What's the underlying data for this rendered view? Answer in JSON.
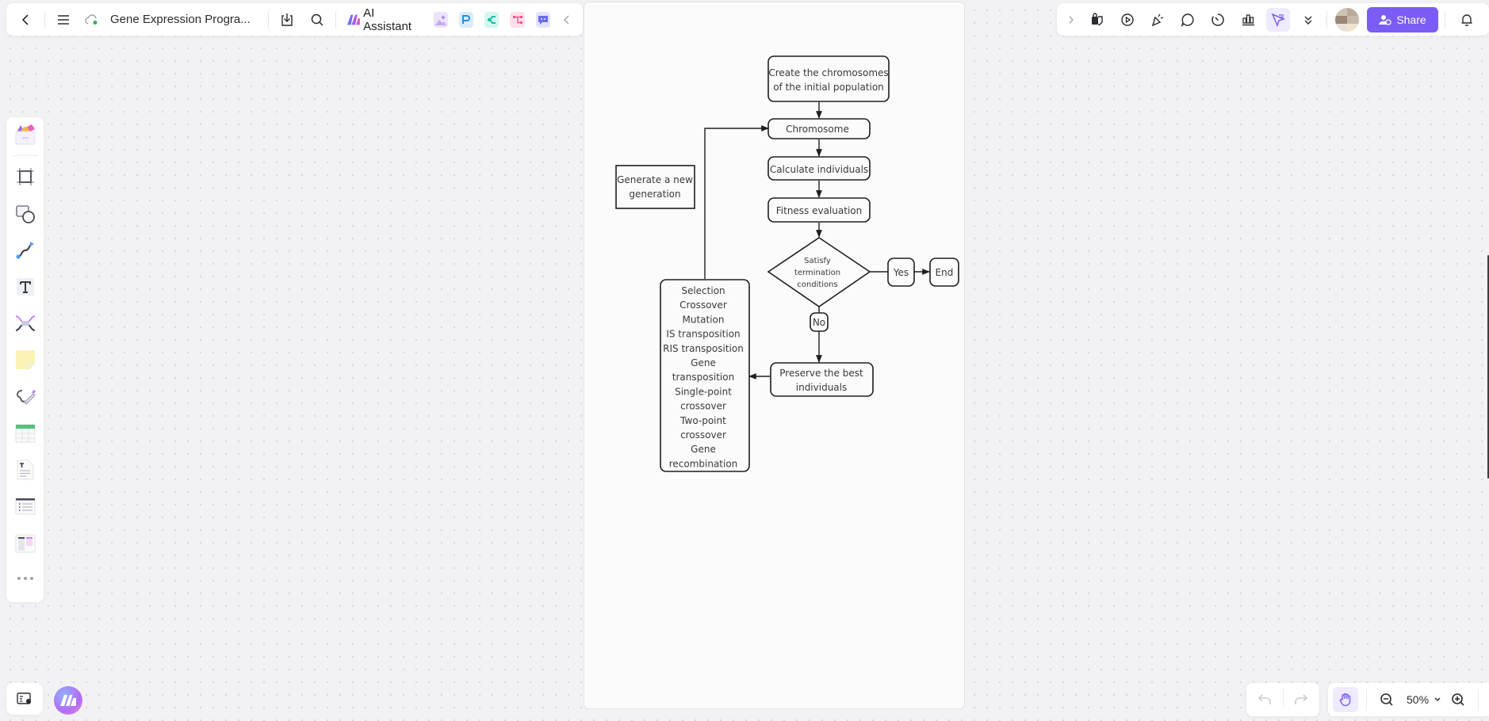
{
  "toolbar_left": {
    "back_icon": "chevron-left-icon",
    "menu_icon": "hamburger-icon",
    "cloud_status_icon": "cloud-synced-icon",
    "document_title": "Gene Expression Progra...",
    "download_icon": "download-icon",
    "search_icon": "search-icon",
    "ai_assistant_label": "AI Assistant",
    "quick_tools": [
      "ai-image-icon",
      "ai-presentation-icon",
      "ai-mindmap-icon",
      "ai-flowchart-icon",
      "ai-chat-icon"
    ],
    "collapse_icon": "chevron-left-icon"
  },
  "toolbar_right": {
    "expand_icon": "chevron-right-icon",
    "tools": [
      "sticker-icon",
      "present-icon",
      "celebrate-icon",
      "comment-icon",
      "timer-icon",
      "vote-icon",
      "laser-pointer-icon",
      "more-icon"
    ],
    "active_tool": "laser-pointer-icon",
    "share_label": "Share",
    "notification_icon": "bell-icon"
  },
  "left_rail": {
    "tools": [
      "templates",
      "frame",
      "shapes",
      "connector",
      "text",
      "mindmap",
      "sticky-note",
      "pen",
      "table",
      "text-doc",
      "list",
      "kanban",
      "more"
    ]
  },
  "bottom_right": {
    "zoom_level": "50%"
  },
  "colors": {
    "accent": "#7b5cf5",
    "canvas_bg": "#f2f2f4",
    "page_bg": "#fbfbfb",
    "node_stroke": "#1f1f1f",
    "node_text": "#3a3a3f"
  },
  "diagram": {
    "nodes": {
      "create": [
        "Create the chromosomes",
        "of the initial population"
      ],
      "chromosome": [
        "Chromosome"
      ],
      "calculate": [
        "Calculate individuals"
      ],
      "fitness": [
        "Fitness evaluation"
      ],
      "decision": [
        "Satisfy",
        "termination",
        "conditions"
      ],
      "yes": [
        "Yes"
      ],
      "end": [
        "End"
      ],
      "no": [
        "No"
      ],
      "preserve": [
        "Preserve the best",
        "individuals"
      ],
      "operators": [
        "Selection",
        "Crossover",
        "Mutation",
        "IS transposition",
        "RIS transposition",
        "Gene",
        "transposition",
        "Single-point",
        "crossover",
        "Two-point",
        "crossover",
        "Gene",
        "recombination"
      ],
      "generate": [
        "Generate a new",
        "generation"
      ]
    }
  }
}
